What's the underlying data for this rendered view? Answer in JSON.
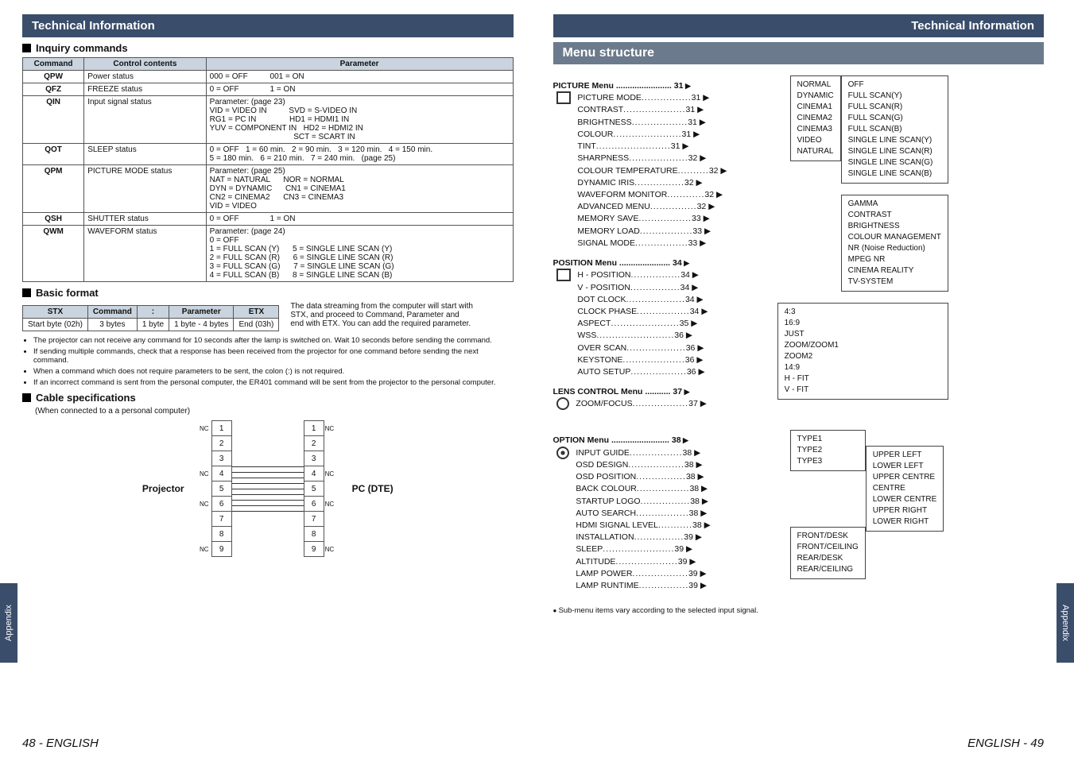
{
  "left": {
    "header": "Technical Information",
    "appendix": "Appendix",
    "pageNum": "48 - ENGLISH",
    "inquiry": {
      "title": "Inquiry commands",
      "headers": [
        "Command",
        "Control contents",
        "Parameter"
      ],
      "rows": [
        {
          "cmd": "QPW",
          "ctrl": "Power status",
          "param": "000 = OFF          001 = ON"
        },
        {
          "cmd": "QFZ",
          "ctrl": "FREEZE status",
          "param": "0 = OFF              1 = ON"
        },
        {
          "cmd": "QIN",
          "ctrl": "Input signal status",
          "param": "Parameter: (page 23)\nVID = VIDEO IN          SVD = S-VIDEO IN\nRG1 = PC IN               HD1 = HDMI1 IN\nYUV = COMPONENT IN   HD2 = HDMI2 IN\n                                      SCT = SCART IN"
        },
        {
          "cmd": "QOT",
          "ctrl": "SLEEP status",
          "param": "0 = OFF   1 = 60 min.   2 = 90 min.   3 = 120 min.   4 = 150 min.\n5 = 180 min.   6 = 210 min.   7 = 240 min.   (page 25)"
        },
        {
          "cmd": "QPM",
          "ctrl": "PICTURE MODE status",
          "param": "Parameter: (page 25)\nNAT = NATURAL      NOR = NORMAL\nDYN = DYNAMIC      CN1 = CINEMA1\nCN2 = CINEMA2      CN3 = CINEMA3\nVID = VIDEO"
        },
        {
          "cmd": "QSH",
          "ctrl": "SHUTTER status",
          "param": "0 = OFF              1 = ON"
        },
        {
          "cmd": "QWM",
          "ctrl": "WAVEFORM status",
          "param": "Parameter: (page 24)\n0 = OFF\n1 = FULL SCAN (Y)      5 = SINGLE LINE SCAN (Y)\n2 = FULL SCAN (R)      6 = SINGLE LINE SCAN (R)\n3 = FULL SCAN (G)      7 = SINGLE LINE SCAN (G)\n4 = FULL SCAN (B)      8 = SINGLE LINE SCAN (B)"
        }
      ]
    },
    "basic": {
      "title": "Basic format",
      "headers": [
        "STX",
        "Command",
        ":",
        "Parameter",
        "ETX"
      ],
      "row": [
        "Start byte (02h)",
        "3 bytes",
        "1 byte",
        "1 byte - 4 bytes",
        "End (03h)"
      ],
      "note": "The data streaming from the computer will start with STX, and proceed to Command, Parameter and end with ETX. You can add the required parameter."
    },
    "notes": [
      "The projector can not receive any command for 10 seconds after the lamp is switched on. Wait 10 seconds before sending the command.",
      "If sending multiple commands, check that a response has been received from the projector for one command before sending the next command.",
      "When a command which does not require parameters to be sent, the colon (:) is not required.",
      "If an incorrect command is sent from the personal computer, the ER401 command will be sent from the projector to the personal computer."
    ],
    "cable": {
      "title": "Cable specifications",
      "sub": "(When connected to a a personal computer)",
      "leftLabel": "Projector",
      "rightLabel": "PC (DTE)",
      "nc": "NC",
      "pins": [
        "1",
        "2",
        "3",
        "4",
        "5",
        "6",
        "7",
        "8",
        "9"
      ]
    }
  },
  "right": {
    "header": "Technical Information",
    "appendix": "Appendix",
    "pageNum": "ENGLISH - 49",
    "menuTitle": "Menu structure",
    "picture": {
      "title": "PICTURE Menu ........................ 31",
      "items": [
        [
          "PICTURE MODE",
          "31"
        ],
        [
          "CONTRAST",
          "31"
        ],
        [
          "BRIGHTNESS",
          "31"
        ],
        [
          "COLOUR",
          "31"
        ],
        [
          "TINT",
          "31"
        ],
        [
          "SHARPNESS",
          "32"
        ],
        [
          "COLOUR TEMPERATURE",
          "32"
        ],
        [
          "DYNAMIC IRIS",
          "32"
        ],
        [
          "WAVEFORM MONITOR",
          "32"
        ],
        [
          "ADVANCED MENU",
          "32"
        ],
        [
          "MEMORY SAVE",
          "33"
        ],
        [
          "MEMORY LOAD",
          "33"
        ],
        [
          "SIGNAL MODE",
          "33"
        ]
      ]
    },
    "position": {
      "title": "POSITION Menu ...................... 34",
      "items": [
        [
          "H - POSITION",
          "34"
        ],
        [
          "V - POSITION",
          "34"
        ],
        [
          "DOT CLOCK",
          "34"
        ],
        [
          "CLOCK PHASE",
          "34"
        ],
        [
          "ASPECT",
          "35"
        ],
        [
          "WSS",
          "36"
        ],
        [
          "OVER SCAN",
          "36"
        ],
        [
          "KEYSTONE",
          "36"
        ],
        [
          "AUTO SETUP",
          "36"
        ]
      ]
    },
    "lens": {
      "title": "LENS CONTROL Menu ........... 37",
      "items": [
        [
          "ZOOM/FOCUS",
          "37"
        ]
      ]
    },
    "option": {
      "title": "OPTION Menu ......................... 38",
      "items": [
        [
          "INPUT GUIDE",
          "38"
        ],
        [
          "OSD DESIGN",
          "38"
        ],
        [
          "OSD POSITION",
          "38"
        ],
        [
          "BACK COLOUR",
          "38"
        ],
        [
          "STARTUP LOGO",
          "38"
        ],
        [
          "AUTO SEARCH",
          "38"
        ],
        [
          "HDMI SIGNAL LEVEL",
          "38"
        ],
        [
          "INSTALLATION",
          "39"
        ],
        [
          "SLEEP",
          "39"
        ],
        [
          "ALTITUDE",
          "39"
        ],
        [
          "LAMP POWER",
          "39"
        ],
        [
          "LAMP RUNTIME",
          "39"
        ]
      ]
    },
    "boxes": {
      "pictureMode": [
        "NORMAL",
        "DYNAMIC",
        "CINEMA1",
        "CINEMA2",
        "CINEMA3",
        "VIDEO",
        "NATURAL"
      ],
      "waveform": [
        "OFF",
        "FULL SCAN(Y)",
        "FULL SCAN(R)",
        "FULL SCAN(G)",
        "FULL SCAN(B)",
        "SINGLE LINE SCAN(Y)",
        "SINGLE LINE SCAN(R)",
        "SINGLE LINE SCAN(G)",
        "SINGLE LINE SCAN(B)"
      ],
      "advanced": [
        "GAMMA",
        "CONTRAST",
        "BRIGHTNESS",
        "COLOUR MANAGEMENT",
        "NR (Noise Reduction)",
        "MPEG NR",
        "CINEMA REALITY",
        "TV-SYSTEM"
      ],
      "aspect": [
        "4:3",
        "16:9",
        "JUST",
        "ZOOM/ZOOM1",
        "ZOOM2",
        "14:9",
        "H - FIT",
        "V - FIT"
      ],
      "osdDesign": [
        "TYPE1",
        "TYPE2",
        "TYPE3"
      ],
      "osdPos": [
        "UPPER LEFT",
        "LOWER LEFT",
        "UPPER CENTRE",
        "CENTRE",
        "LOWER CENTRE",
        "UPPER RIGHT",
        "LOWER RIGHT"
      ],
      "install": [
        "FRONT/DESK",
        "FRONT/CEILING",
        "REAR/DESK",
        "REAR/CEILING"
      ]
    },
    "footnote": "Sub-menu items vary according to the selected input signal."
  }
}
